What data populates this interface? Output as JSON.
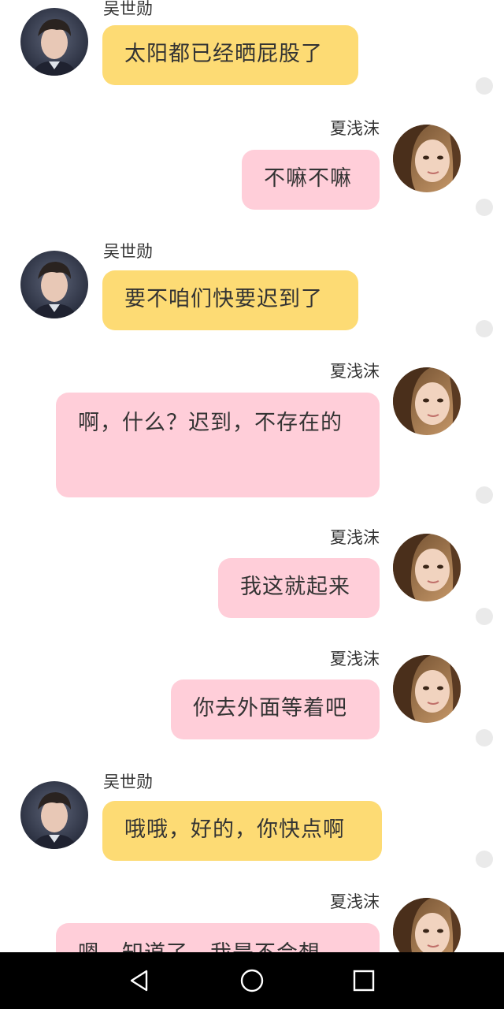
{
  "contacts": {
    "male": "吴世勋",
    "female": "夏浅沫"
  },
  "messages": [
    {
      "sender": "吴世勋",
      "side": "left",
      "text": "太阳都已经晒屁股了"
    },
    {
      "sender": "夏浅沫",
      "side": "right",
      "text": "不嘛不嘛"
    },
    {
      "sender": "吴世勋",
      "side": "left",
      "text": "要不咱们快要迟到了"
    },
    {
      "sender": "夏浅沫",
      "side": "right",
      "text": "啊，什么？迟到，不存在的"
    },
    {
      "sender": "夏浅沫",
      "side": "right",
      "text": "我这就起来"
    },
    {
      "sender": "夏浅沫",
      "side": "right",
      "text": "你去外面等着吧"
    },
    {
      "sender": "吴世勋",
      "side": "left",
      "text": "哦哦，好的，你快点啊"
    },
    {
      "sender": "夏浅沫",
      "side": "right",
      "text": "嗯，知道了，我是不会想"
    }
  ],
  "colors": {
    "left_bubble": "#FDDB74",
    "right_bubble": "#FFCED9",
    "nav_bar": "#000000"
  },
  "icons": {
    "nav_back": "triangle-back-icon",
    "nav_home": "circle-home-icon",
    "nav_recent": "square-recent-icon"
  }
}
